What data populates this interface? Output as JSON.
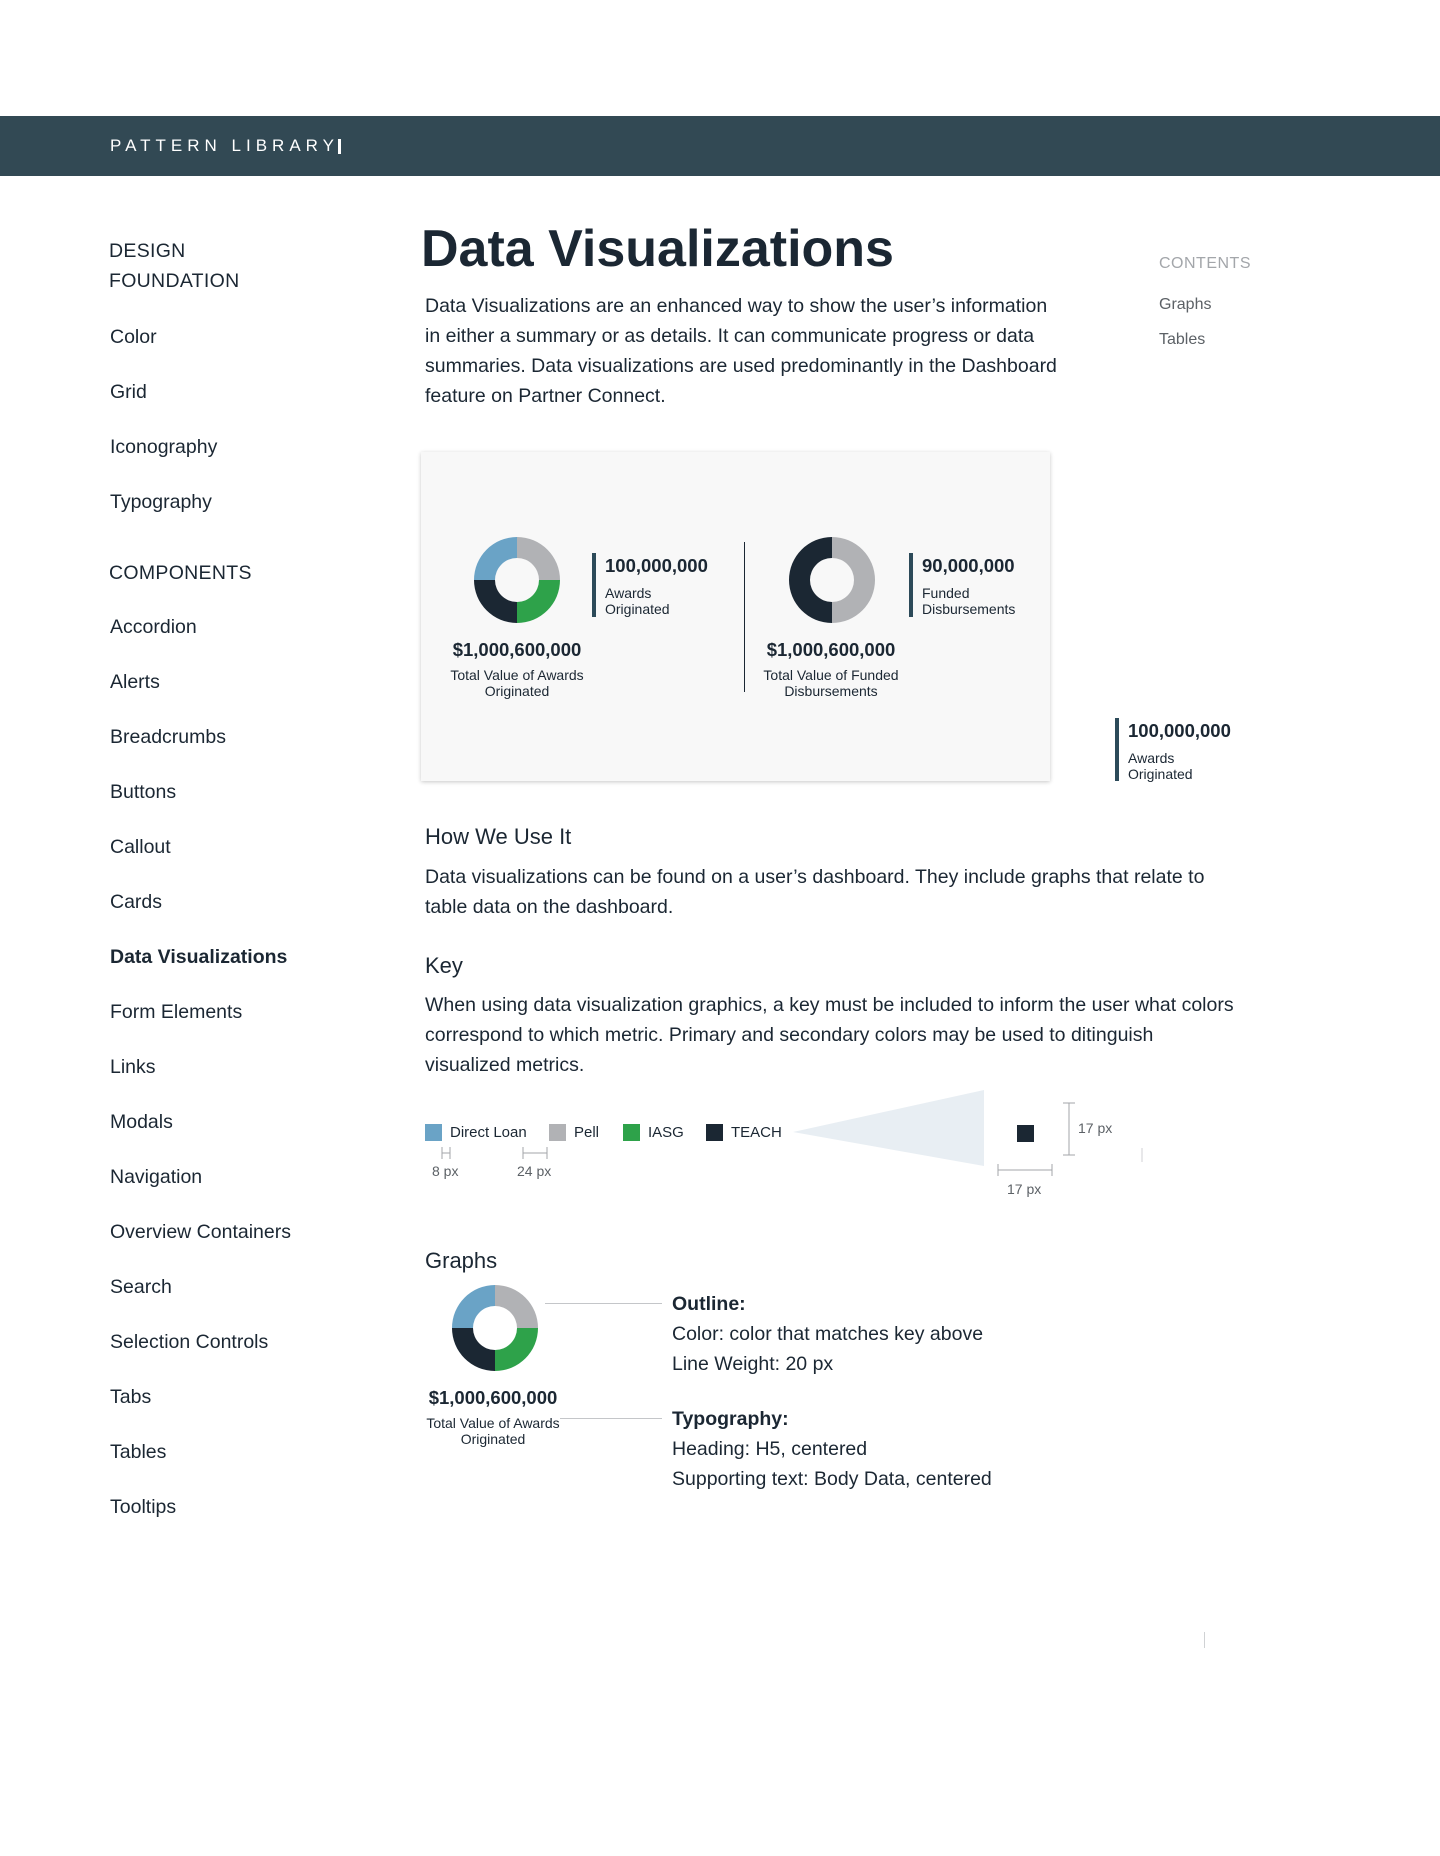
{
  "header": {
    "title": "PATTERN LIBRARY"
  },
  "sidebar": {
    "section1": "DESIGN FOUNDATION",
    "foundation_items": [
      "Color",
      "Grid",
      "Iconography",
      "Typography"
    ],
    "section2": "COMPONENTS",
    "component_items": [
      "Accordion",
      "Alerts",
      "Breadcrumbs",
      "Buttons",
      "Callout",
      "Cards",
      "Data Visualizations",
      "Form Elements",
      "Links",
      "Modals",
      "Navigation",
      "Overview Containers",
      "Search",
      "Selection Controls",
      "Tabs",
      "Tables",
      "Tooltips"
    ],
    "active": "Data Visualizations"
  },
  "page": {
    "title": "Data Visualizations",
    "intro": "Data Visualizations are an enhanced way to show the user’s information in either a summary or as details. It can communicate progress or data summaries. Data visualizations are used predominantly in the Dashboard feature on Partner Connect."
  },
  "toc": {
    "title": "CONTENTS",
    "links": [
      "Graphs",
      "Tables"
    ]
  },
  "colors": {
    "direct_loan": "#6aa3c6",
    "pell": "#b1b2b5",
    "iasg": "#2ea24a",
    "teach": "#1b2733",
    "accent_bar": "#2c4a59",
    "header_bg": "#324954"
  },
  "example_card": {
    "left": {
      "stat_value": "100,000,000",
      "stat_label": "Awards Originated",
      "total_value": "$1,000,600,000",
      "total_label": "Total Value of Awards Originated"
    },
    "right": {
      "stat_value": "90,000,000",
      "stat_label": "Funded Disbursements",
      "total_value": "$1,000,600,000",
      "total_label": "Total Value of Funded Disbursements"
    }
  },
  "floating_stat": {
    "value": "100,000,000",
    "label": "Awards Originated"
  },
  "how_we_use": {
    "heading": "How We Use It",
    "text": "Data visualizations can be found on a user’s dashboard. They include graphs that relate to table data on the dashboard."
  },
  "key": {
    "heading": "Key",
    "text": "When using data visualization graphics, a key must be included to inform the user what colors correspond to which metric. Primary and secondary colors may be used to ditinguish visualized metrics.",
    "legend": [
      {
        "label": "Direct Loan",
        "color": "#6aa3c6"
      },
      {
        "label": "Pell",
        "color": "#b1b2b5"
      },
      {
        "label": "IASG",
        "color": "#2ea24a"
      },
      {
        "label": "TEACH",
        "color": "#1b2733"
      }
    ],
    "measure_gap": "8 px",
    "measure_spacing": "24 px",
    "measure_height": "17 px",
    "measure_width": "17 px"
  },
  "graphs": {
    "heading": "Graphs",
    "total_value": "$1,000,600,000",
    "total_label": "Total Value of Awards Originated",
    "outline_title": "Outline:",
    "outline_lines": [
      "Color: color that matches key above",
      "Line Weight: 20 px"
    ],
    "typography_title": "Typography:",
    "typography_lines": [
      "Heading: H5, centered",
      "Supporting text: Body Data, centered"
    ]
  }
}
